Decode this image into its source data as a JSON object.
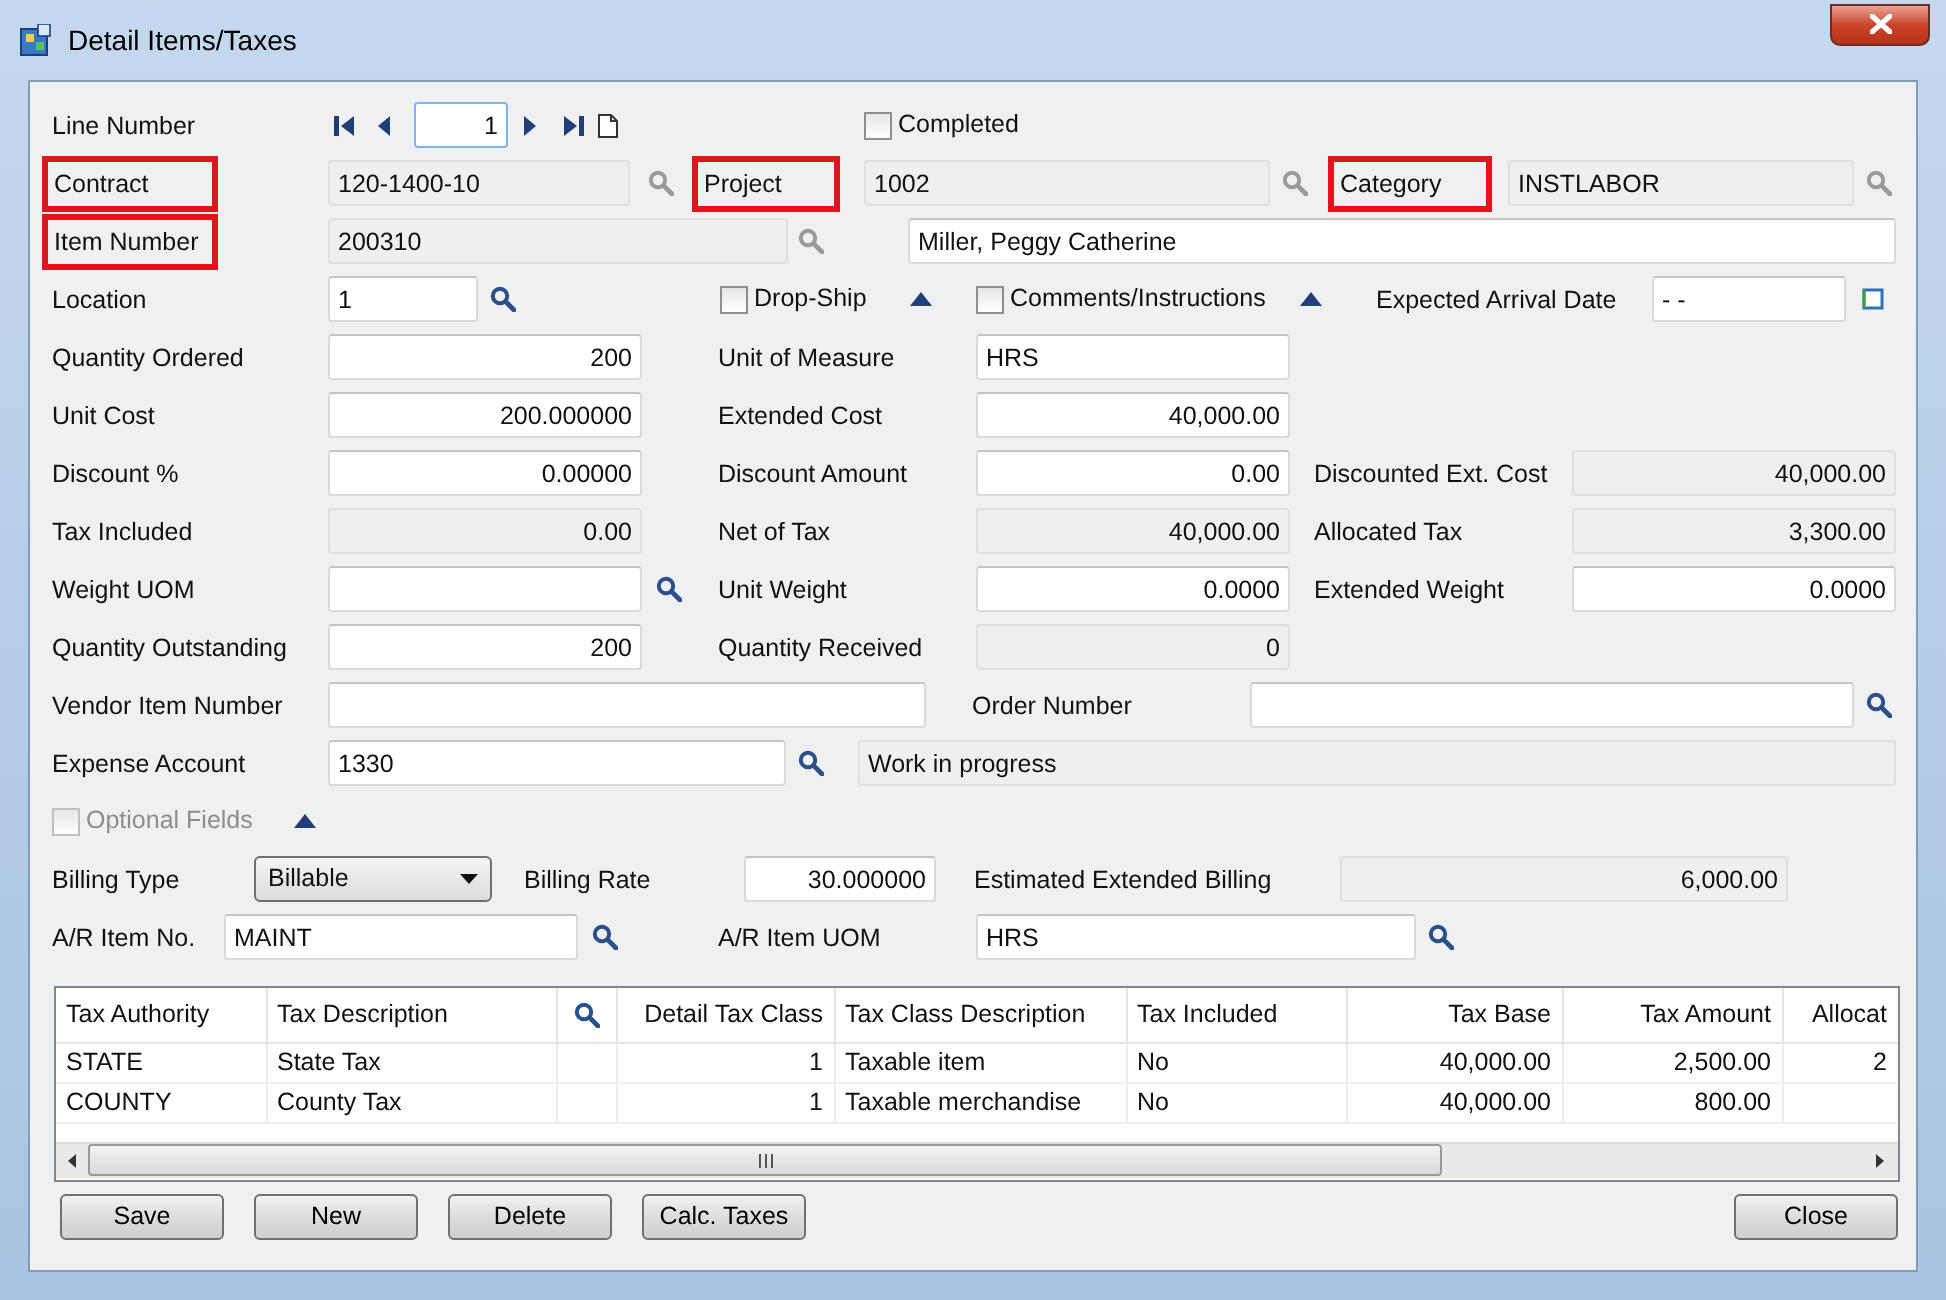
{
  "window": {
    "title": "Detail Items/Taxes"
  },
  "rows": [
    [
      {
        "kind": "label",
        "text": "Line Number",
        "highlighted": false
      },
      {
        "kind": "spinner",
        "value": "1"
      },
      {
        "kind": "checkbox",
        "label": "Completed",
        "checked": false,
        "disabled": false
      }
    ],
    [
      {
        "kind": "label",
        "text": "Contract",
        "highlighted": true
      },
      {
        "kind": "field",
        "value": "120-1400-10",
        "disabled": true
      },
      {
        "kind": "label",
        "text": "Project",
        "highlighted": true
      },
      {
        "kind": "field",
        "value": "1002",
        "disabled": true
      },
      {
        "kind": "label",
        "text": "Category",
        "highlighted": true
      },
      {
        "kind": "field",
        "value": "INSTLABOR",
        "disabled": true
      }
    ],
    [
      {
        "kind": "label",
        "text": "Item Number",
        "highlighted": true
      },
      {
        "kind": "field",
        "value": "200310",
        "disabled": true
      },
      {
        "kind": "field",
        "value": "Miller, Peggy Catherine",
        "disabled": false
      }
    ],
    [
      {
        "kind": "label",
        "text": "Location",
        "highlighted": false
      },
      {
        "kind": "field",
        "value": "1",
        "disabled": false
      },
      {
        "kind": "checkbox",
        "label": "Drop-Ship",
        "checked": false,
        "disabled": false
      },
      {
        "kind": "checkbox",
        "label": "Comments/Instructions",
        "checked": false,
        "disabled": false
      },
      {
        "kind": "label",
        "text": "Expected Arrival Date",
        "highlighted": false
      },
      {
        "kind": "field",
        "value": "- -",
        "disabled": false
      }
    ],
    [
      {
        "kind": "label",
        "text": "Quantity Ordered",
        "highlighted": false
      },
      {
        "kind": "field",
        "value": "200",
        "disabled": false
      },
      {
        "kind": "label",
        "text": "Unit of Measure",
        "highlighted": false
      },
      {
        "kind": "field",
        "value": "HRS",
        "disabled": false
      }
    ],
    [
      {
        "kind": "label",
        "text": "Unit Cost",
        "highlighted": false
      },
      {
        "kind": "field",
        "value": "200.000000",
        "disabled": false
      },
      {
        "kind": "label",
        "text": "Extended Cost",
        "highlighted": false
      },
      {
        "kind": "field",
        "value": "40,000.00",
        "disabled": false
      }
    ],
    [
      {
        "kind": "label",
        "text": "Discount %",
        "highlighted": false
      },
      {
        "kind": "field",
        "value": "0.00000",
        "disabled": false
      },
      {
        "kind": "label",
        "text": "Discount Amount",
        "highlighted": false
      },
      {
        "kind": "field",
        "value": "0.00",
        "disabled": false
      },
      {
        "kind": "label",
        "text": "Discounted Ext. Cost",
        "highlighted": false
      },
      {
        "kind": "field",
        "value": "40,000.00",
        "disabled": true
      }
    ],
    [
      {
        "kind": "label",
        "text": "Tax Included",
        "highlighted": false
      },
      {
        "kind": "field",
        "value": "0.00",
        "disabled": true
      },
      {
        "kind": "label",
        "text": "Net of Tax",
        "highlighted": false
      },
      {
        "kind": "field",
        "value": "40,000.00",
        "disabled": true
      },
      {
        "kind": "label",
        "text": "Allocated Tax",
        "highlighted": false
      },
      {
        "kind": "field",
        "value": "3,300.00",
        "disabled": true
      }
    ],
    [
      {
        "kind": "label",
        "text": "Weight UOM",
        "highlighted": false
      },
      {
        "kind": "field",
        "disabled": false
      },
      {
        "kind": "label",
        "text": "Unit Weight",
        "highlighted": false
      },
      {
        "kind": "field",
        "value": "0.0000",
        "disabled": false
      },
      {
        "kind": "label",
        "text": "Extended Weight",
        "highlighted": false
      },
      {
        "kind": "field",
        "value": "0.0000",
        "disabled": false
      }
    ],
    [
      {
        "kind": "label",
        "text": "Quantity Outstanding",
        "highlighted": false
      },
      {
        "kind": "field",
        "value": "200",
        "disabled": false
      },
      {
        "kind": "label",
        "text": "Quantity Received",
        "highlighted": false
      },
      {
        "kind": "field",
        "value": "0",
        "disabled": true
      }
    ],
    [
      {
        "kind": "label",
        "text": "Vendor Item Number",
        "highlighted": false
      },
      {
        "kind": "field",
        "disabled": false
      },
      {
        "kind": "label",
        "text": "Order Number",
        "highlighted": false
      },
      {
        "kind": "field",
        "disabled": false
      }
    ],
    [
      {
        "kind": "label",
        "text": "Expense Account",
        "highlighted": false
      },
      {
        "kind": "field",
        "value": "1330",
        "disabled": false
      },
      {
        "kind": "field",
        "value": "Work in progress",
        "disabled": true
      }
    ],
    [
      {
        "kind": "checkbox",
        "label": "Optional Fields",
        "checked": false,
        "disabled": true
      }
    ],
    [
      {
        "kind": "label",
        "text": "Billing Type",
        "highlighted": false
      },
      {
        "kind": "select",
        "value": "Billable"
      },
      {
        "kind": "label",
        "text": "Billing Rate",
        "highlighted": false
      },
      {
        "kind": "field",
        "value": "30.000000",
        "disabled": false
      },
      {
        "kind": "label",
        "text": "Estimated Extended Billing",
        "highlighted": false
      },
      {
        "kind": "field",
        "value": "6,000.00",
        "disabled": true
      }
    ],
    [
      {
        "kind": "label",
        "text": "A/R Item No.",
        "highlighted": false
      },
      {
        "kind": "field",
        "value": "MAINT",
        "disabled": false
      },
      {
        "kind": "label",
        "text": "A/R Item UOM",
        "highlighted": false
      },
      {
        "kind": "field",
        "value": "HRS",
        "disabled": false
      }
    ]
  ],
  "tax_table": {
    "columns": [
      "Tax Authority",
      "Tax Description",
      "Detail Tax Class",
      "Tax Class Description",
      "Tax Included",
      "Tax Base",
      "Tax Amount",
      "Allocat"
    ],
    "rows": [
      {
        "cells": [
          "STATE",
          "State Tax",
          "1",
          "Taxable item",
          "No",
          "40,000.00",
          "2,500.00",
          "2"
        ]
      },
      {
        "cells": [
          "COUNTY",
          "County Tax",
          "1",
          "Taxable merchandise",
          "No",
          "40,000.00",
          "800.00"
        ]
      }
    ]
  },
  "buttons": [
    {
      "label": "Save"
    },
    {
      "label": "New"
    },
    {
      "label": "Delete"
    },
    {
      "label": "Calc. Taxes"
    },
    {
      "label": "Close"
    }
  ]
}
